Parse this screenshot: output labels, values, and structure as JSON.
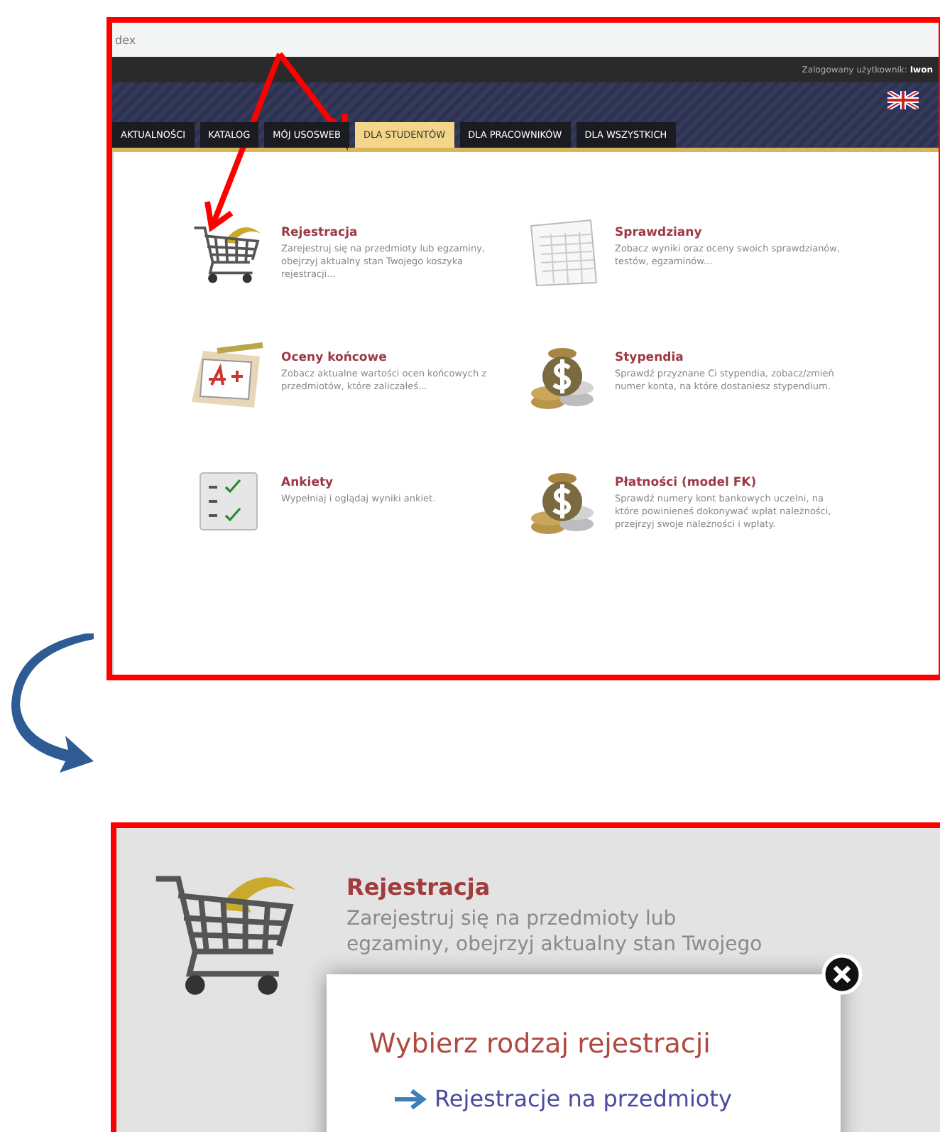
{
  "browser": {
    "address": "dex"
  },
  "top_bar": {
    "user_label": "Zalogowany użytkownik:",
    "user_name": "Iwon"
  },
  "tabs": [
    {
      "label": "AKTUALNOŚCI",
      "selected": false
    },
    {
      "label": "KATALOG",
      "selected": false
    },
    {
      "label": "MÓJ USOSWEB",
      "selected": false
    },
    {
      "label": "DLA STUDENTÓW",
      "selected": true
    },
    {
      "label": "DLA PRACOWNIKÓW",
      "selected": false
    },
    {
      "label": "DLA WSZYSTKICH",
      "selected": false
    }
  ],
  "tiles": [
    {
      "title": "Rejestracja",
      "description": "Zarejestruj się na przedmioty lub egzaminy, obejrzyj aktualny stan Twojego koszyka rejestracji..."
    },
    {
      "title": "Sprawdziany",
      "description": "Zobacz wyniki oraz oceny swoich sprawdzianów, testów, egzaminów..."
    },
    {
      "title": "Oceny końcowe",
      "description": "Zobacz aktualne wartości ocen końcowych z przedmiotów, które zaliczałeś..."
    },
    {
      "title": "Stypendia",
      "description": "Sprawdź przyznane Ci stypendia, zobacz/zmień numer konta, na które dostaniesz stypendium."
    },
    {
      "title": "Ankiety",
      "description": "Wypełniaj i oglądaj wyniki ankiet."
    },
    {
      "title": "Płatności (model FK)",
      "description": "Sprawdź numery kont bankowych uczelni, na które powinieneś dokonywać wpłat należności, przejrzyj swoje należności i wpłaty."
    }
  ],
  "detail": {
    "title": "Rejestracja",
    "description": "Zarejestruj się na przedmioty lub egzaminy, obejrzyj aktualny stan Twojego",
    "dialog": {
      "title": "Wybierz rodzaj rejestracji",
      "link": "Rejestracje na przedmioty"
    }
  }
}
